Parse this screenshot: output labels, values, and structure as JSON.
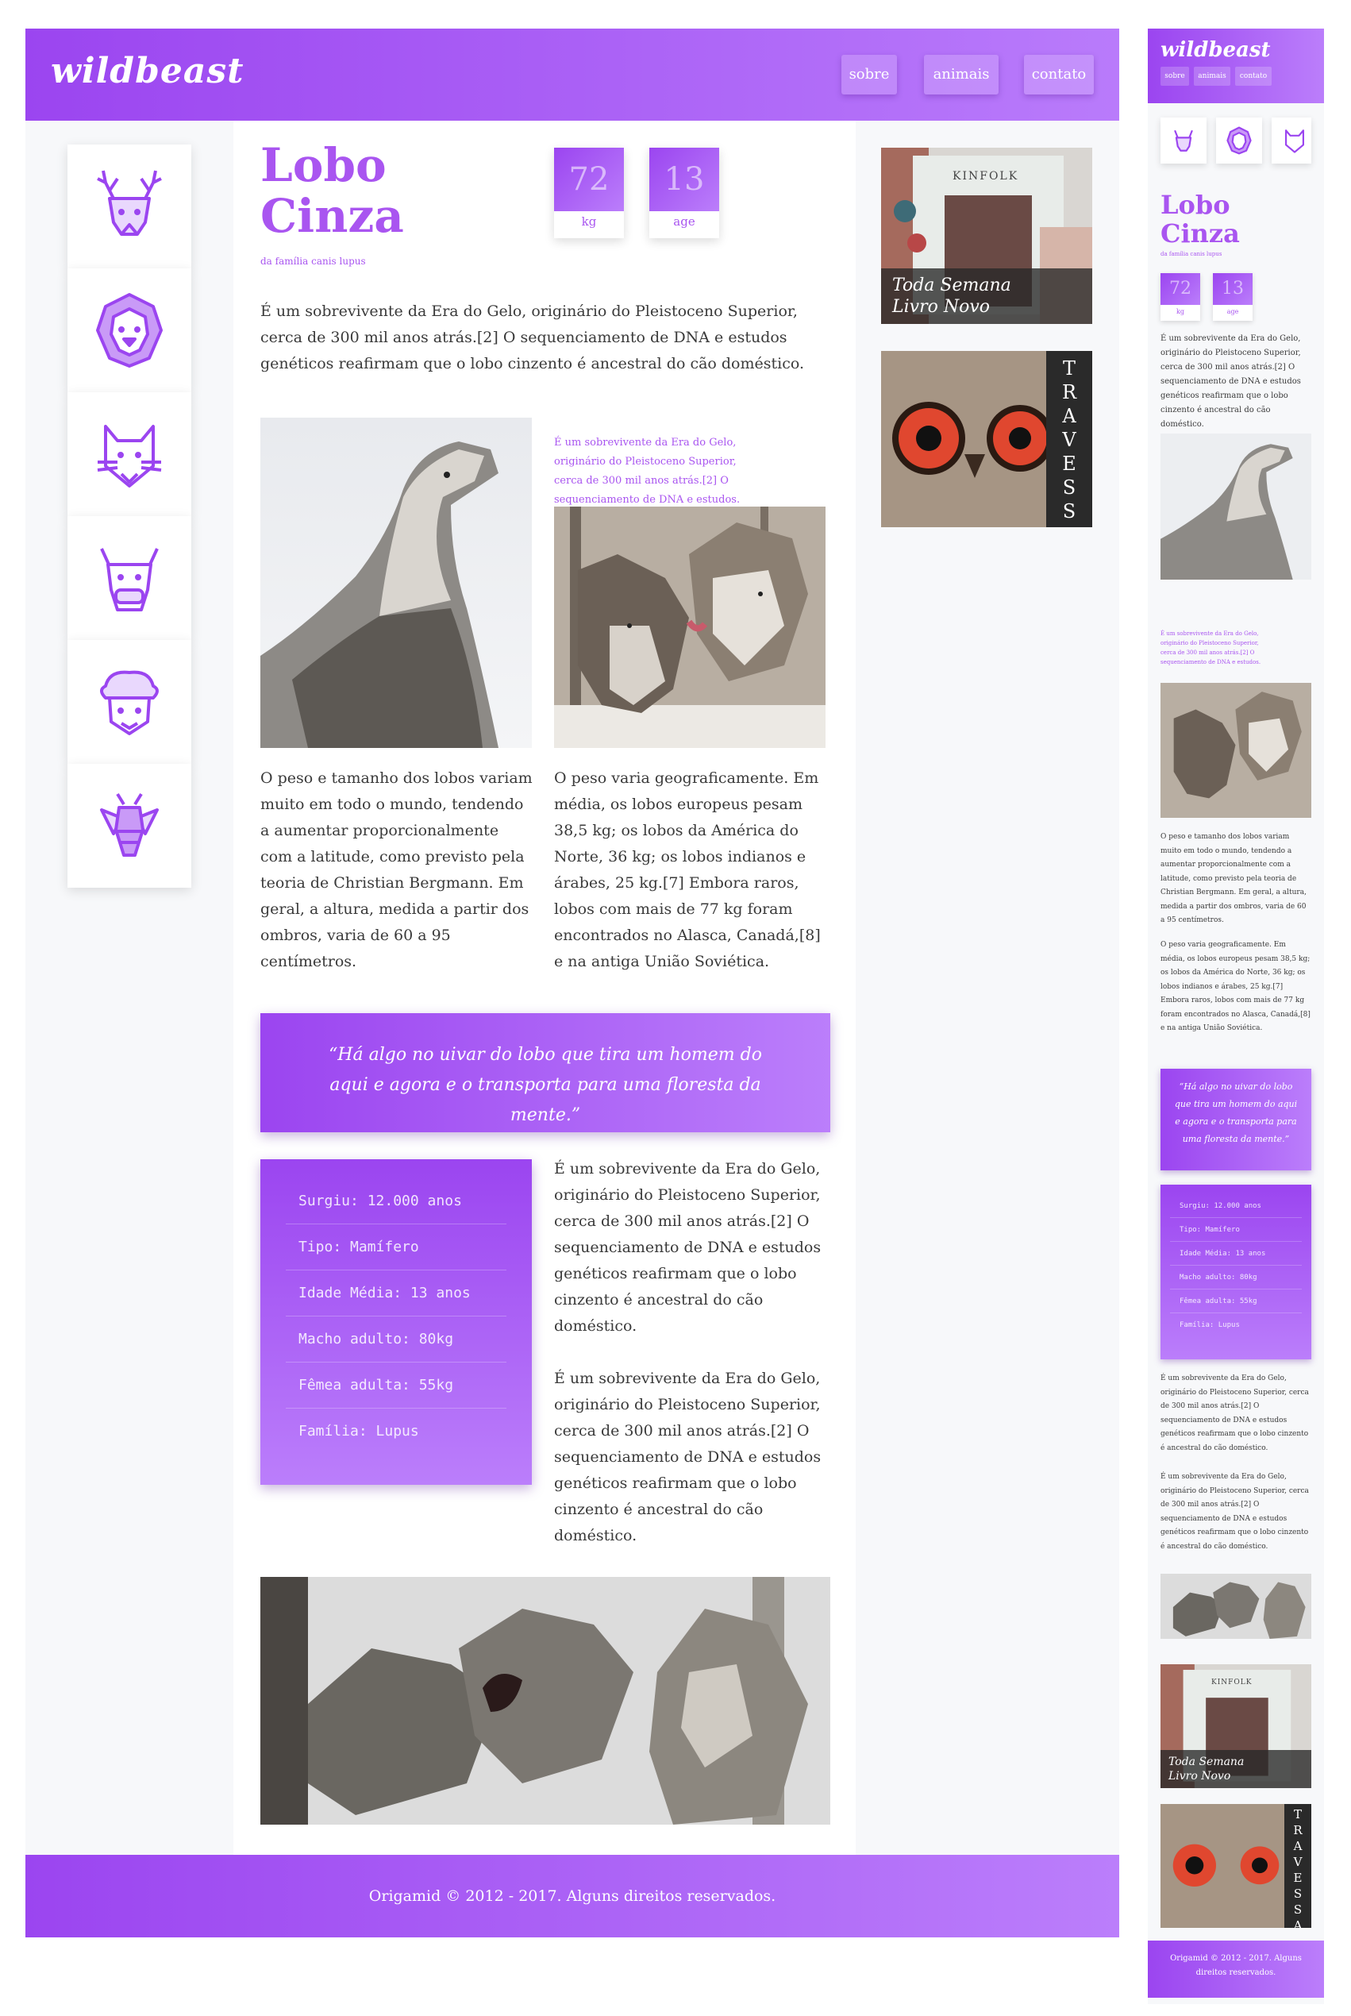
{
  "brand": {
    "logo": "wildbeast",
    "accent": "#a955f0",
    "gradient_start": "#9b45f0",
    "gradient_end": "#bb7efb"
  },
  "nav": [
    {
      "label": "sobre"
    },
    {
      "label": "animais"
    },
    {
      "label": "contato"
    }
  ],
  "animal_icons": [
    "deer-icon",
    "lion-icon",
    "fox-icon",
    "bull-icon",
    "sheep-icon",
    "bee-icon"
  ],
  "article": {
    "title_line1": "Lobo",
    "title_line2": "Cinza",
    "subtitle": "da família canis lupus",
    "stats": [
      {
        "value": "72",
        "label": "kg"
      },
      {
        "value": "13",
        "label": "age"
      }
    ],
    "intro": "É um sobrevivente da Era do Gelo, originário do Pleistoceno Superior, cerca de 300 mil anos atrás.[2] O sequenciamento de DNA e estudos genéticos reafirmam que o lobo cinzento é ancestral do cão doméstico.",
    "caption": "É um sobrevivente da Era do Gelo, originário do Pleistoceno Superior, cerca de 300 mil anos atrás.[2] O sequenciamento de DNA e estudos.",
    "col_left": "O peso e tamanho dos lobos variam muito em todo o mundo, tendendo a aumentar proporcionalmente com a latitude, como previsto pela teoria de Christian Bergmann. Em geral, a altura, medida a partir dos ombros, varia de 60 a 95 centímetros.",
    "col_right": "O peso varia geograficamente. Em média, os lobos europeus pesam 38,5 kg; os lobos da América do Norte, 36 kg; os lobos indianos e árabes, 25 kg.[7] Embora raros, lobos com mais de 77 kg foram encontrados no Alasca, Canadá,[8] e na antiga União Soviética.",
    "quote": "“Há algo no uivar do lobo que tira um homem do aqui e agora e o transporta para uma floresta da mente.”",
    "facts": [
      "Surgiu: 12.000 anos",
      "Tipo: Mamífero",
      "Idade Média: 13 anos",
      "Macho adulto: 80kg",
      "Fêmea adulta: 55kg",
      "Família: Lupus"
    ],
    "side_text_1": "É um sobrevivente da Era do Gelo, originário do Pleistoceno Superior, cerca de 300 mil anos atrás.[2] O sequenciamento de DNA e estudos genéticos reafirmam que o lobo cinzento é ancestral do cão doméstico.",
    "side_text_2": "É um sobrevivente da Era do Gelo, originário do Pleistoceno Superior, cerca de 300 mil anos atrás.[2] O sequenciamento de DNA e estudos genéticos reafirmam que o lobo cinzento é ancestral do cão doméstico."
  },
  "ads": {
    "ad1_brand": "KINFOLK",
    "ad1_caption_line1": "Toda Semana",
    "ad1_caption_line2": "Livro Novo",
    "ad2_text": "TRAVESSA"
  },
  "footer": {
    "text": "Origamid © 2012 - 2017. Alguns direitos reservados."
  }
}
